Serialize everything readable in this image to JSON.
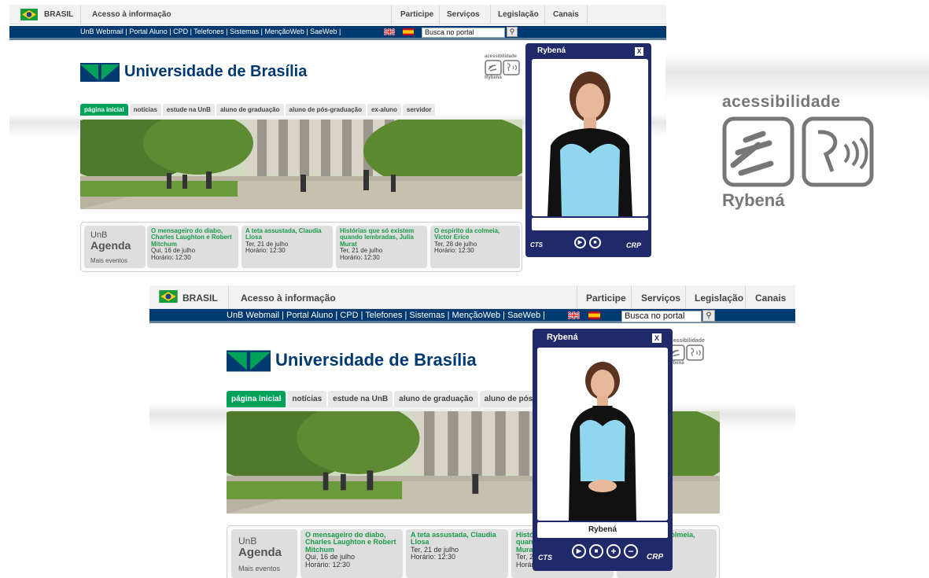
{
  "gov_bar": {
    "country": "BRASIL",
    "acesso": "Acesso à informação",
    "links": [
      "Participe",
      "Serviços",
      "Legislação",
      "Canais"
    ]
  },
  "blue_bar": {
    "links": "UnB Webmail  |  Portal Aluno  |  CPD  |  Telefones  |  Sistemas  |  MençãoWeb  |  SaeWeb  |",
    "search_placeholder": "Busca no portal"
  },
  "site": {
    "title": "Universidade de Brasília",
    "tabs": [
      "página inicial",
      "notícias",
      "estude na UnB",
      "aluno de graduação",
      "aluno de pós-graduação",
      "ex-aluno",
      "servidor"
    ],
    "tabs_short": [
      "página inicial",
      "notícias",
      "estude na UnB",
      "aluno de graduação",
      "aluno de pós-g"
    ]
  },
  "agenda": {
    "label_top": "UnB",
    "label_main": "Agenda",
    "more": "Mais eventos",
    "events": [
      {
        "title": "O mensageiro do diabo, Charles Laughton e Robert Mitchum",
        "date": "Qui, 16 de julho",
        "time": "Horário: 12:30"
      },
      {
        "title": "A teta assustada, Claudia Llosa",
        "date": "Ter, 21 de julho",
        "time": "Horário: 12:30"
      },
      {
        "title": "Histórias que só existem quando lembradas, Julia Murat",
        "date": "Ter, 21 de julho",
        "time": "Horário: 12:30"
      },
      {
        "title": "O espírito da colmeia, Victor Erice",
        "date": "Ter, 28 de julho",
        "time": "Horário: 12:30"
      }
    ]
  },
  "accessibility": {
    "label": "acessibilidade",
    "brand": "Rybená"
  },
  "rybena": {
    "title": "Rybená",
    "close": "X",
    "caption": "Rybená",
    "left_logo": "CTS",
    "right_logo": "CRP"
  },
  "colors": {
    "navy": "#003a70",
    "green": "#00a259",
    "rybena": "#202a6b"
  }
}
